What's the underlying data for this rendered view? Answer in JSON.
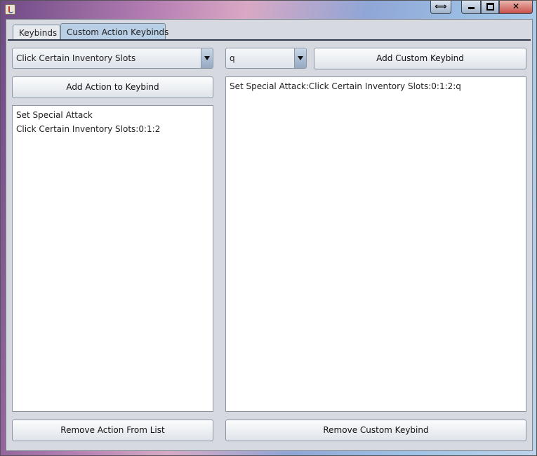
{
  "window": {
    "buttons": {
      "resize": "⟺",
      "close": "✕"
    }
  },
  "tabs": [
    {
      "label": "Keybinds",
      "active": false
    },
    {
      "label": "Custom Action Keybinds",
      "active": true
    }
  ],
  "left_panel": {
    "action_select": {
      "value": "Click Certain Inventory Slots"
    },
    "add_action_button": "Add Action to Keybind",
    "actions_list": [
      "Set Special Attack",
      "Click Certain Inventory Slots:0:1:2"
    ],
    "remove_action_button": "Remove Action From List"
  },
  "right_panel": {
    "key_select": {
      "value": "q"
    },
    "add_custom_button": "Add Custom Keybind",
    "custom_keybinds_list": [
      "Set Special Attack:Click Certain Inventory Slots:0:1:2:q"
    ],
    "remove_custom_button": "Remove Custom Keybind"
  }
}
